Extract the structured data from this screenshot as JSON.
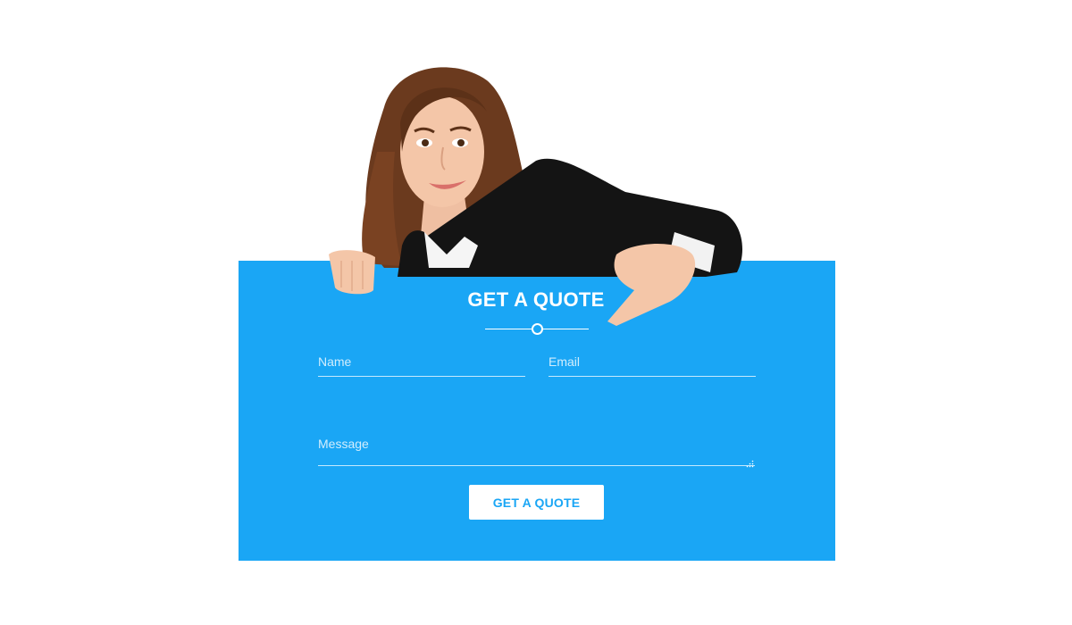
{
  "quote_form": {
    "title": "GET A QUOTE",
    "name_placeholder": "Name",
    "email_placeholder": "Email",
    "message_placeholder": "Message",
    "submit_label": "GET A QUOTE"
  },
  "colors": {
    "panel_background": "#1aa6f5",
    "button_background": "#ffffff",
    "button_text": "#1aa6f5",
    "page_background": "#ffffff"
  },
  "icons": {
    "divider": "ring-divider-icon",
    "resize": "resize-grip-icon"
  }
}
